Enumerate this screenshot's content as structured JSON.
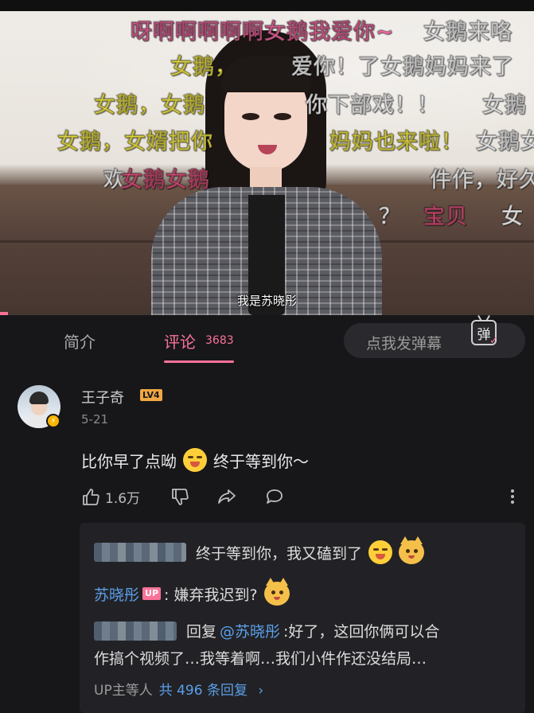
{
  "video": {
    "subtitle": "我是苏晓彤",
    "danmaku": [
      {
        "text": "呀啊啊啊啊啊女鹅我爱你~",
        "color": "pink"
      },
      {
        "text": "女鹅来咯",
        "color": "white"
      },
      {
        "text": "女鹅，",
        "color": "yellow"
      },
      {
        "text": "爱你！了女鹅妈妈来了",
        "color": "white"
      },
      {
        "text": "女鹅，女鹅",
        "color": "yellow"
      },
      {
        "text": "你下部戏！！",
        "color": "white"
      },
      {
        "text": "女鹅",
        "color": "white"
      },
      {
        "text": "女鹅，女婿把你",
        "color": "yellow"
      },
      {
        "text": "妈妈也来啦！",
        "color": "yellow"
      },
      {
        "text": "女鹅女",
        "color": "white"
      },
      {
        "text": "欢",
        "color": "white"
      },
      {
        "text": "女鹅女鹅",
        "color": "rose"
      },
      {
        "text": "件作，好久",
        "color": "white"
      },
      {
        "text": "？",
        "color": "white"
      },
      {
        "text": "宝贝",
        "color": "rose"
      },
      {
        "text": "女",
        "color": "white"
      }
    ]
  },
  "tabs": {
    "intro_label": "简介",
    "comments_label": "评论",
    "comments_count": "3683",
    "danmaku_placeholder": "点我发弹幕",
    "danmaku_button_glyph": "弹"
  },
  "comment": {
    "username": "王子奇",
    "level": "LV4",
    "date": "5-21",
    "text_before_emoji": "比你早了点呦",
    "text_after_emoji": "终于等到你～",
    "likes": "1.6万",
    "replies": [
      {
        "text": "终于等到你，我又磕到了"
      },
      {
        "author": "苏晓彤",
        "badge": "UP",
        "text": ": 嫌弃我迟到?"
      },
      {
        "prefix": "回复",
        "mention": "@苏晓彤",
        "text": ":好了，这回你俩可以合",
        "text2": "作搞个视频了…我等着啊…我们小件作还没结局…"
      }
    ],
    "footer_prefix": "UP主等人",
    "footer_count": "共 496 条回复",
    "footer_arrow": "›"
  },
  "colors": {
    "accent": "#fb7299",
    "link": "#5b9fe8",
    "background": "#17171a"
  }
}
